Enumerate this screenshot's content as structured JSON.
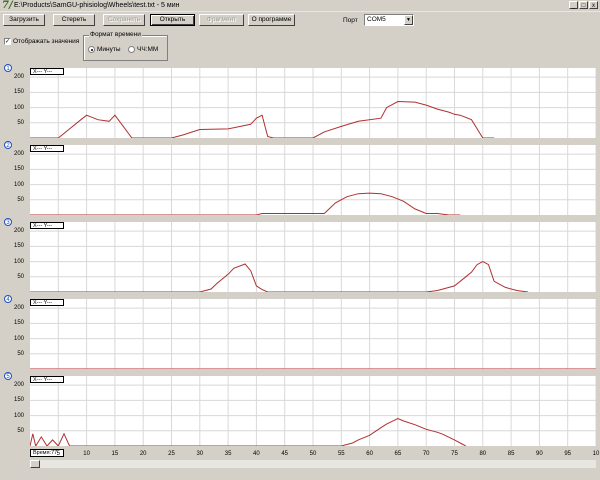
{
  "window": {
    "title": "E:\\Products\\SamGU-phisiolog\\Wheels\\test.txt - 5 мин",
    "app_icon": "7/",
    "min_glyph": "_",
    "max_glyph": "□",
    "close_glyph": "x"
  },
  "toolbar": {
    "load": "Загрузить",
    "erase": "Стереть",
    "save": "Сохранить",
    "open": "Открыть",
    "fragment": "Фрагмент",
    "about": "О программе",
    "port_label": "Порт",
    "port_value": "COM5"
  },
  "options": {
    "show_values": "Отображать значения",
    "time_format_legend": "Формат времени",
    "minutes": "Минуты",
    "hhmm": "ЧЧ:ММ"
  },
  "plot_labels": {
    "coord_readout": "X--- Y---",
    "y_ticks": [
      "200",
      "150",
      "100",
      "50"
    ],
    "x_ticks": [
      "5",
      "10",
      "15",
      "20",
      "25",
      "30",
      "35",
      "40",
      "45",
      "50",
      "55",
      "60",
      "65",
      "70",
      "75",
      "80",
      "85",
      "90",
      "95",
      "10"
    ],
    "time_readout": "Время:77"
  },
  "channels": [
    {
      "number": "1"
    },
    {
      "number": "2"
    },
    {
      "number": "3"
    },
    {
      "number": "4"
    },
    {
      "number": "5"
    }
  ],
  "colors": {
    "curve": "#b03030",
    "badge": "#1f4fbf"
  },
  "chart_data": [
    {
      "type": "line",
      "series": [
        {
          "x": [
            0,
            5,
            7,
            9,
            10,
            12,
            14,
            15,
            16,
            18,
            20,
            25,
            27,
            30,
            35,
            39,
            40,
            41,
            42,
            43,
            45,
            50,
            52,
            55,
            58,
            62,
            63,
            65,
            68,
            70,
            72,
            74,
            75,
            76,
            78,
            80,
            81,
            82
          ],
          "values": [
            0,
            0,
            30,
            60,
            75,
            60,
            55,
            75,
            50,
            0,
            0,
            0,
            10,
            28,
            30,
            45,
            65,
            75,
            5,
            0,
            0,
            0,
            20,
            38,
            55,
            65,
            100,
            120,
            118,
            108,
            95,
            85,
            78,
            75,
            60,
            0,
            0,
            0
          ]
        }
      ],
      "xlim": [
        0,
        100
      ],
      "ylim": [
        0,
        230
      ]
    },
    {
      "type": "line",
      "series": [
        {
          "x": [
            0,
            40,
            41,
            43,
            45,
            48,
            52,
            54,
            56,
            58,
            60,
            62,
            64,
            66,
            68,
            70,
            72,
            74,
            76
          ],
          "values": [
            0,
            0,
            5,
            5,
            5,
            5,
            5,
            40,
            60,
            70,
            72,
            70,
            60,
            45,
            20,
            5,
            5,
            0,
            0
          ]
        }
      ],
      "xlim": [
        0,
        100
      ],
      "ylim": [
        0,
        230
      ]
    },
    {
      "type": "line",
      "series": [
        {
          "x": [
            0,
            30,
            32,
            33,
            35,
            36,
            38,
            39,
            40,
            41,
            42,
            43,
            45,
            70,
            72,
            75,
            77,
            78,
            79,
            80,
            81,
            82,
            84,
            86,
            88
          ],
          "values": [
            0,
            0,
            10,
            28,
            58,
            78,
            92,
            70,
            20,
            8,
            0,
            0,
            0,
            0,
            5,
            20,
            50,
            65,
            90,
            100,
            90,
            35,
            15,
            5,
            0
          ]
        }
      ],
      "xlim": [
        0,
        100
      ],
      "ylim": [
        0,
        230
      ]
    },
    {
      "type": "line",
      "series": [
        {
          "x": [
            0,
            100
          ],
          "values": [
            0,
            0
          ]
        }
      ],
      "xlim": [
        0,
        100
      ],
      "ylim": [
        0,
        230
      ]
    },
    {
      "type": "line",
      "series": [
        {
          "x": [
            0,
            0.5,
            1,
            2,
            3,
            4,
            5,
            6,
            7,
            55,
            57,
            58,
            60,
            62,
            63,
            65,
            66,
            68,
            70,
            72,
            73,
            75,
            76,
            77
          ],
          "values": [
            0,
            40,
            0,
            30,
            0,
            20,
            0,
            40,
            0,
            0,
            10,
            20,
            35,
            60,
            72,
            90,
            82,
            70,
            55,
            45,
            38,
            20,
            10,
            0
          ],
          "x_note": ""
        }
      ],
      "xlim": [
        0,
        100
      ],
      "ylim": [
        0,
        230
      ]
    }
  ]
}
